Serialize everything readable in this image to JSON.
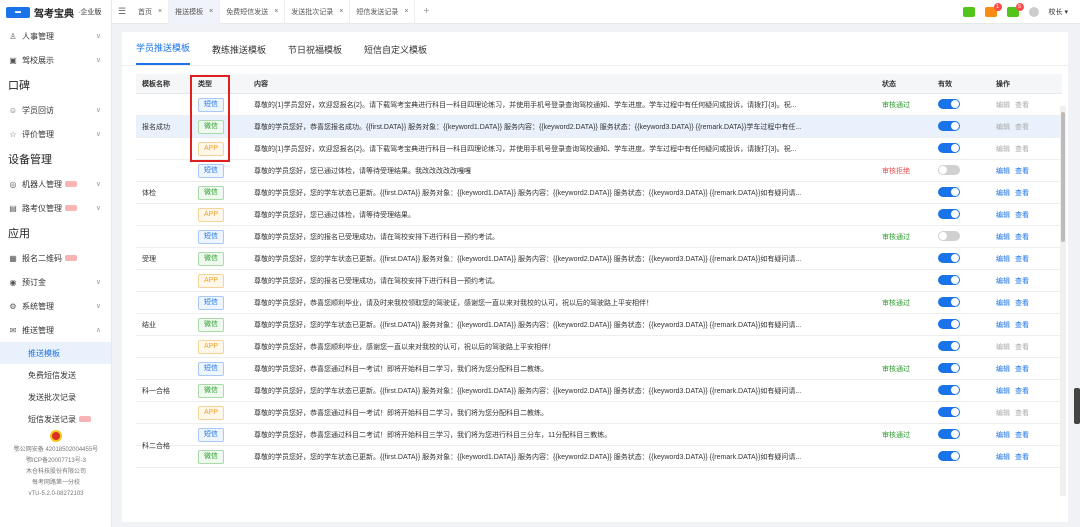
{
  "app": {
    "logo_mark": "驾考宝典",
    "logo_text": "驾考宝典",
    "logo_sub": "·企业版"
  },
  "sidebar": {
    "items": [
      {
        "label": "人事管理",
        "icon": "person-icon",
        "glyph": "♙",
        "chevron": true
      },
      {
        "label": "驾校展示",
        "icon": "display-icon",
        "glyph": "▣",
        "chevron": true
      }
    ],
    "group1": "口碑",
    "items2": [
      {
        "label": "学员回访",
        "icon": "chat-icon",
        "glyph": "☺",
        "chevron": true
      },
      {
        "label": "评价管理",
        "icon": "star-icon",
        "glyph": "☆",
        "chevron": true
      }
    ],
    "group2": "设备管理",
    "items3": [
      {
        "label": "机器人管理",
        "icon": "robot-icon",
        "glyph": "◎",
        "chevron": true,
        "badge": true
      },
      {
        "label": "路考仪管理",
        "icon": "device-icon",
        "glyph": "▤",
        "chevron": true,
        "badge": true
      }
    ],
    "group3": "应用",
    "items4": [
      {
        "label": "报名二维码",
        "icon": "qrcode-icon",
        "glyph": "▦",
        "chevron": false,
        "badge": true
      },
      {
        "label": "预订金",
        "icon": "money-icon",
        "glyph": "◉",
        "chevron": true
      },
      {
        "label": "系统管理",
        "icon": "gear-icon",
        "glyph": "⚙",
        "chevron": true
      },
      {
        "label": "推送管理",
        "icon": "mail-icon",
        "glyph": "✉",
        "chevron": true
      }
    ],
    "sub": [
      {
        "label": "推送模板",
        "active": true
      },
      {
        "label": "免费短信发送",
        "active": false
      },
      {
        "label": "发送批次记录",
        "active": false
      },
      {
        "label": "短信发送记录",
        "active": false,
        "badge": true
      }
    ],
    "footer": [
      "鄂公网安备 42018502004455号",
      "鄂ICP备20007713号-3",
      "木仓科技股份有限公司",
      "每考网路第一分校",
      "vTU-5.2.0-08272103"
    ]
  },
  "tabs": [
    {
      "label": "首页",
      "active": false
    },
    {
      "label": "推送模板",
      "active": true
    },
    {
      "label": "免费短信发送",
      "active": false
    },
    {
      "label": "发送批次记录",
      "active": false
    },
    {
      "label": "短信发送记录",
      "active": false
    }
  ],
  "topbar": {
    "badge1": "1",
    "badge2": "5",
    "user": "校长 ▾",
    "menu_toggle": "☰",
    "tab_close": "×",
    "tab_add": "+"
  },
  "subtabs": [
    {
      "label": "学员推送模板",
      "active": true
    },
    {
      "label": "教练推送模板",
      "active": false
    },
    {
      "label": "节日祝福模板",
      "active": false
    },
    {
      "label": "短信自定义模板",
      "active": false
    }
  ],
  "table": {
    "headers": {
      "name": "模板名称",
      "type": "类型",
      "content": "内容",
      "status": "状态",
      "valid": "有效",
      "ops": "操作"
    },
    "edit": "编辑",
    "view": "查看",
    "groups": [
      {
        "name": "报名成功",
        "rows": [
          {
            "type": "短信",
            "cls": "sms",
            "content": "尊敬的{1}学员您好，欢迎您报名{2}。请下载驾考宝典进行科目一科目四理论练习，并使用手机号登录查询驾校通知、学车进度。学车过程中有任何疑问或投诉，请拨打{3}。祝...",
            "status": "审核通过",
            "scls": "st-ok",
            "on": true,
            "ops": "dim"
          },
          {
            "type": "微信",
            "cls": "wx",
            "content": "尊敬的学员您好，恭喜您报名成功。{{first.DATA}} 服务对象：{{keyword1.DATA}} 服务内容：{{keyword2.DATA}} 服务状态：{{keyword3.DATA}} {{remark.DATA}}学车过程中有任...",
            "status": "",
            "scls": "",
            "on": true,
            "ops": "dim",
            "hl": true
          },
          {
            "type": "APP",
            "cls": "app",
            "content": "尊敬的{1}学员您好，欢迎您报名{2}。请下载驾考宝典进行科目一科目四理论练习，并使用手机号登录查询驾校通知、学车进度。学车过程中有任何疑问或投诉，请拨打{3}。祝...",
            "status": "",
            "scls": "",
            "on": true,
            "ops": "dim"
          }
        ]
      },
      {
        "name": "体检",
        "rows": [
          {
            "type": "短信",
            "cls": "sms",
            "content": "尊敬的学员您好，您已通过体检，请等待受理结果。我改改改改改嘎嘎",
            "status": "审核拒绝",
            "scls": "st-bad",
            "on": false,
            "ops": "on"
          },
          {
            "type": "微信",
            "cls": "wx",
            "content": "尊敬的学员您好，您的学车状态已更新。{{first.DATA}} 服务对象：{{keyword1.DATA}} 服务内容：{{keyword2.DATA}} 服务状态：{{keyword3.DATA}} {{remark.DATA}}如有疑问请...",
            "status": "",
            "scls": "",
            "on": true,
            "ops": "on"
          },
          {
            "type": "APP",
            "cls": "app",
            "content": "尊敬的学员您好，您已通过体检，请等待受理结果。",
            "status": "",
            "scls": "",
            "on": true,
            "ops": "on"
          }
        ]
      },
      {
        "name": "受理",
        "rows": [
          {
            "type": "短信",
            "cls": "sms",
            "content": "尊敬的学员您好，您的报名已受理成功，请在驾校安排下进行科目一预约考试。",
            "status": "审核通过",
            "scls": "st-ok",
            "on": false,
            "ops": "on"
          },
          {
            "type": "微信",
            "cls": "wx",
            "content": "尊敬的学员您好，您的学车状态已更新。{{first.DATA}} 服务对象：{{keyword1.DATA}} 服务内容：{{keyword2.DATA}} 服务状态：{{keyword3.DATA}} {{remark.DATA}}如有疑问请...",
            "status": "",
            "scls": "",
            "on": true,
            "ops": "on"
          },
          {
            "type": "APP",
            "cls": "app",
            "content": "尊敬的学员您好，您的报名已受理成功，请在驾校安排下进行科目一预约考试。",
            "status": "",
            "scls": "",
            "on": true,
            "ops": "on"
          }
        ]
      },
      {
        "name": "结业",
        "rows": [
          {
            "type": "短信",
            "cls": "sms",
            "content": "尊敬的学员您好，恭喜您顺利毕业，请及时来我校领取您的驾驶证，感谢您一直以来对我校的认可，祝以后的驾驶路上平安相伴！",
            "status": "审核通过",
            "scls": "st-ok",
            "on": true,
            "ops": "on"
          },
          {
            "type": "微信",
            "cls": "wx",
            "content": "尊敬的学员您好，您的学车状态已更新。{{first.DATA}} 服务对象：{{keyword1.DATA}} 服务内容：{{keyword2.DATA}} 服务状态：{{keyword3.DATA}} {{remark.DATA}}如有疑问请...",
            "status": "",
            "scls": "",
            "on": true,
            "ops": "on"
          },
          {
            "type": "APP",
            "cls": "app",
            "content": "尊敬的学员您好，恭喜您顺利毕业，感谢您一直以来对我校的认可，祝以后的驾驶路上平安相伴！",
            "status": "",
            "scls": "",
            "on": true,
            "ops": "dim"
          }
        ]
      },
      {
        "name": "科一合格",
        "rows": [
          {
            "type": "短信",
            "cls": "sms",
            "content": "尊敬的学员您好，恭喜您通过科目一考试！即将开始科目二学习，我们将为您分配科目二教练。",
            "status": "审核通过",
            "scls": "st-ok",
            "on": true,
            "ops": "on"
          },
          {
            "type": "微信",
            "cls": "wx",
            "content": "尊敬的学员您好，您的学车状态已更新。{{first.DATA}} 服务对象：{{keyword1.DATA}} 服务内容：{{keyword2.DATA}} 服务状态：{{keyword3.DATA}} {{remark.DATA}}如有疑问请...",
            "status": "",
            "scls": "",
            "on": true,
            "ops": "on"
          },
          {
            "type": "APP",
            "cls": "app",
            "content": "尊敬的学员您好，恭喜您通过科目一考试！即将开始科目二学习，我们将为您分配科目二教练。",
            "status": "",
            "scls": "",
            "on": true,
            "ops": "dim"
          }
        ]
      },
      {
        "name": "科二合格",
        "rows": [
          {
            "type": "短信",
            "cls": "sms",
            "content": "尊敬的学员您好，恭喜您通过科目二考试！即将开始科目三学习，我们将为您进行科目三分车，11分配科目三教练。",
            "status": "审核通过",
            "scls": "st-ok",
            "on": true,
            "ops": "on"
          },
          {
            "type": "微信",
            "cls": "wx",
            "content": "尊敬的学员您好，您的学车状态已更新。{{first.DATA}} 服务对象：{{keyword1.DATA}} 服务内容：{{keyword2.DATA}} 服务状态：{{keyword3.DATA}} {{remark.DATA}}如有疑问请...",
            "status": "",
            "scls": "",
            "on": true,
            "ops": "on"
          }
        ]
      }
    ]
  }
}
